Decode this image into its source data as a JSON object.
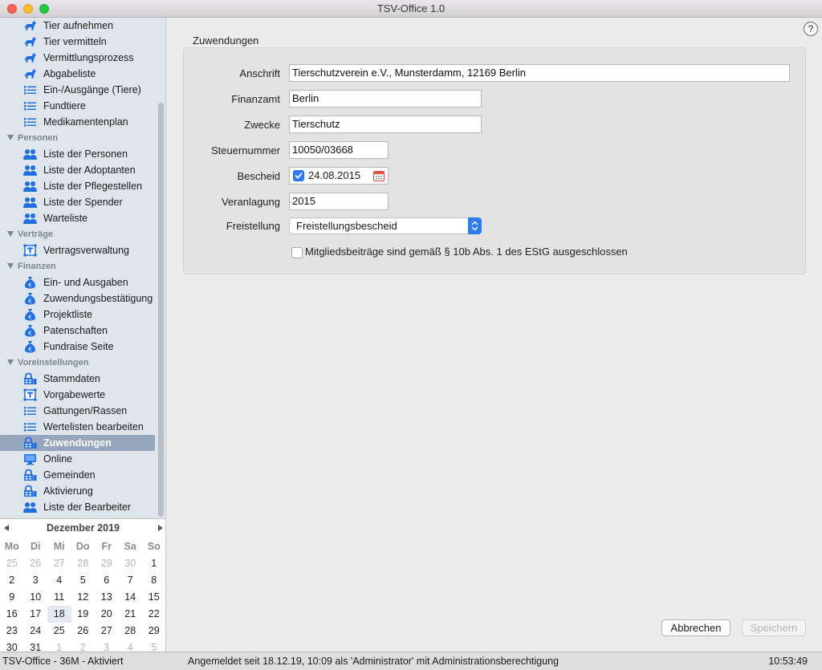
{
  "window": {
    "title": "TSV-Office 1.0"
  },
  "sidebar": {
    "rows": [
      {
        "kind": "item",
        "label": "Tier aufnehmen",
        "icon": "dog-icon"
      },
      {
        "kind": "item",
        "label": "Tier vermitteln",
        "icon": "dog-icon"
      },
      {
        "kind": "item",
        "label": "Vermittlungsprozess",
        "icon": "dog-icon"
      },
      {
        "kind": "item",
        "label": "Abgabeliste",
        "icon": "dog-icon"
      },
      {
        "kind": "item",
        "label": "Ein-/Ausgänge (Tiere)",
        "icon": "list-icon"
      },
      {
        "kind": "item",
        "label": "Fundtiere",
        "icon": "list-icon"
      },
      {
        "kind": "item",
        "label": "Medikamentenplan",
        "icon": "list-icon"
      },
      {
        "kind": "group",
        "label": "Personen"
      },
      {
        "kind": "item",
        "label": "Liste der Personen",
        "icon": "people-icon"
      },
      {
        "kind": "item",
        "label": "Liste der Adoptanten",
        "icon": "people-icon"
      },
      {
        "kind": "item",
        "label": "Liste der Pflegestellen",
        "icon": "people-icon"
      },
      {
        "kind": "item",
        "label": "Liste der Spender",
        "icon": "people-icon"
      },
      {
        "kind": "item",
        "label": "Warteliste",
        "icon": "people-icon"
      },
      {
        "kind": "group",
        "label": "Verträge"
      },
      {
        "kind": "item",
        "label": "Vertragsverwaltung",
        "icon": "text-frame-icon"
      },
      {
        "kind": "group",
        "label": "Finanzen"
      },
      {
        "kind": "item",
        "label": "Ein- und Ausgaben",
        "icon": "money-bag-icon"
      },
      {
        "kind": "item",
        "label": "Zuwendungsbestätigung",
        "icon": "money-bag-icon"
      },
      {
        "kind": "item",
        "label": "Projektliste",
        "icon": "money-bag-icon"
      },
      {
        "kind": "item",
        "label": "Patenschaften",
        "icon": "money-bag-icon"
      },
      {
        "kind": "item",
        "label": "Fundraise Seite",
        "icon": "money-bag-icon"
      },
      {
        "kind": "group",
        "label": "Voreinstellungen"
      },
      {
        "kind": "item",
        "label": "Stammdaten",
        "icon": "lock-icon"
      },
      {
        "kind": "item",
        "label": "Vorgabewerte",
        "icon": "text-frame-icon"
      },
      {
        "kind": "item",
        "label": "Gattungen/Rassen",
        "icon": "list-icon"
      },
      {
        "kind": "item",
        "label": "Wertelisten bearbeiten",
        "icon": "list-icon"
      },
      {
        "kind": "item",
        "label": "Zuwendungen",
        "icon": "lock-icon",
        "selected": true
      },
      {
        "kind": "item",
        "label": "Online",
        "icon": "monitor-icon"
      },
      {
        "kind": "item",
        "label": "Gemeinden",
        "icon": "lock-icon"
      },
      {
        "kind": "item",
        "label": "Aktivierung",
        "icon": "lock-icon"
      },
      {
        "kind": "item",
        "label": "Liste der Bearbeiter",
        "icon": "people-icon"
      }
    ]
  },
  "calendar": {
    "month": "Dezember 2019",
    "weekdays": [
      "Mo",
      "Di",
      "Mi",
      "Do",
      "Fr",
      "Sa",
      "So"
    ],
    "weeks": [
      [
        "25",
        "26",
        "27",
        "28",
        "29",
        "30",
        "1"
      ],
      [
        "2",
        "3",
        "4",
        "5",
        "6",
        "7",
        "8"
      ],
      [
        "9",
        "10",
        "11",
        "12",
        "13",
        "14",
        "15"
      ],
      [
        "16",
        "17",
        "18",
        "19",
        "20",
        "21",
        "22"
      ],
      [
        "23",
        "24",
        "25",
        "26",
        "27",
        "28",
        "29"
      ],
      [
        "30",
        "31",
        "1",
        "2",
        "3",
        "4",
        "5"
      ]
    ],
    "today": "18"
  },
  "content": {
    "help_label": "?",
    "section_title": "Zuwendungen",
    "fields": {
      "anschrift": {
        "label": "Anschrift",
        "value": "Tierschutzverein e.V., Munsterdamm, 12169 Berlin"
      },
      "finanzamt": {
        "label": "Finanzamt",
        "value": "Berlin"
      },
      "zwecke": {
        "label": "Zwecke",
        "value": "Tierschutz"
      },
      "steuernummer": {
        "label": "Steuernummer",
        "value": "10050/03668"
      },
      "bescheid": {
        "label": "Bescheid",
        "value": "24.08.2015",
        "checked": true
      },
      "veranlagung": {
        "label": "Veranlagung",
        "value": "2015"
      },
      "freistellung": {
        "label": "Freistellung",
        "value": "Freistellungsbescheid"
      }
    },
    "mitglied_checkbox": {
      "label": "Mitgliedsbeiträge sind gemäß § 10b Abs. 1 des EStG ausgeschlossen",
      "checked": false
    },
    "buttons": {
      "cancel": "Abbrechen",
      "save": "Speichern"
    }
  },
  "status": {
    "left": "TSV-Office - 36M - Aktiviert",
    "center": "Angemeldet seit 18.12.19, 10:09 als 'Administrator' mit Administrationsberechtigung",
    "time": "10:53:49"
  },
  "colors": {
    "accent": "#2f7df6",
    "selection": "#96a6bd",
    "sidebar_bg": "#dfe5ec"
  }
}
